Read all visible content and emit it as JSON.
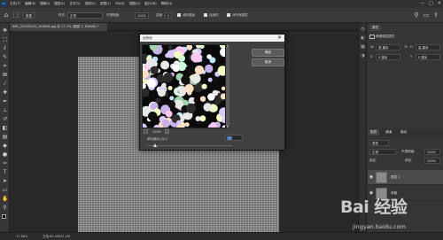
{
  "menubar": {
    "app_logo": "Ps",
    "items": [
      "文件(F)",
      "编辑(E)",
      "图像(I)",
      "图层(L)",
      "文字(Y)",
      "选择(S)",
      "滤镜(T)",
      "3D(D)",
      "视图(V)",
      "窗口(W)",
      "帮助(H)"
    ],
    "window_controls": [
      "—",
      "□",
      "✕"
    ]
  },
  "options_bar": {
    "tool_icon": "rectangle-select-icon",
    "mode_value": "新建",
    "style_label": "样式:",
    "style_value": "正常",
    "opacity_label": "不透明度:",
    "opacity_value": "100%",
    "tolerance_label": "容差:",
    "tolerance_value": "0",
    "antialias_label": "消除锯齿",
    "contiguous_label": "连续的",
    "all_layers_label": "对所有图层"
  },
  "document_tab": {
    "label": "IMG_20200529_144818.jpg @ 17.7% (图层 1, RGB/8) *"
  },
  "status_bar": {
    "zoom": "17.68%",
    "doc_info": "文档:85.4M/91.2M"
  },
  "right_panel": {
    "properties_tab": "属性",
    "properties_title": "像素图层属性",
    "w_label": "W",
    "w_value": "宽 厘米",
    "h_label": "H",
    "h_value": "高 厘米",
    "x_label": "X",
    "x_value": "0 厘米",
    "y_label": "Y",
    "y_value": "0 厘米",
    "layers_tab": "图层",
    "channels_tab": "通道",
    "paths_tab": "路径",
    "kind_value": "类型",
    "blend_value": "正常",
    "opacity_label": "不透明度:",
    "opacity_value": "100%",
    "lock_label": "锁定:",
    "fill_label": "填充:",
    "fill_value": "100%",
    "layers": [
      {
        "name": "图层 1"
      },
      {
        "name": "背景"
      }
    ]
  },
  "dialog": {
    "title": "点状化",
    "ok_label": "确定",
    "cancel_label": "取消",
    "zoom_minus": "−",
    "zoom_value": "100%",
    "zoom_plus": "+",
    "cell_size_label": "单元格大小(C)",
    "cell_size_value": "3",
    "close_icon": "✕"
  },
  "watermark": {
    "text": "Bai 经验",
    "sub": "jingyan.baidu.com"
  },
  "colors": {
    "accent": "#31a8ff",
    "selection": "#3b6fb6",
    "panel": "#353535",
    "canvas_bg": "#282828"
  }
}
